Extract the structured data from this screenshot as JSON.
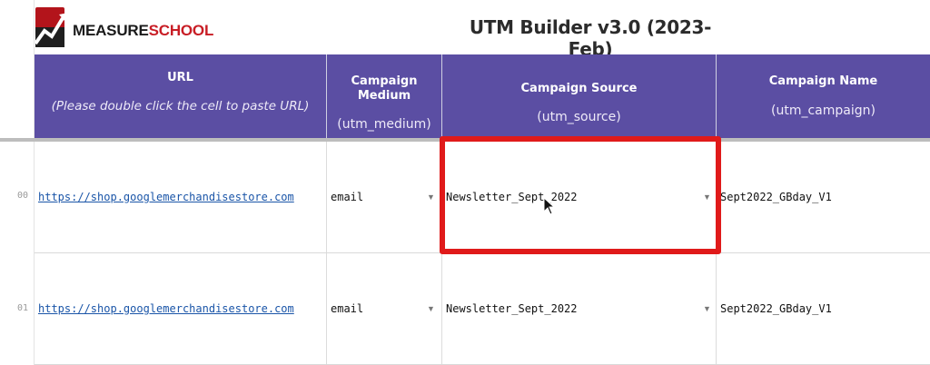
{
  "brand": {
    "logo_text_a": "MEASURE",
    "logo_text_b": "SCHOOL"
  },
  "title": "UTM Builder v3.0 (2023-Feb)",
  "columns": [
    {
      "label": "URL",
      "sub": "(Please double click the cell to paste URL)"
    },
    {
      "label": "Campaign Medium",
      "sub": "(utm_medium)"
    },
    {
      "label": "Campaign Source",
      "sub": "(utm_source)"
    },
    {
      "label": "Campaign Name",
      "sub": "(utm_campaign)"
    }
  ],
  "rows": [
    {
      "num": "00",
      "url": "https://shop.googlemerchandisestore.com",
      "medium": "email",
      "source": "Newsletter_Sept_2022",
      "name": "Sept2022_GBday_V1"
    },
    {
      "num": "01",
      "url": "https://shop.googlemerchandisestore.com",
      "medium": "email",
      "source": "Newsletter_Sept_2022",
      "name": "Sept2022_GBday_V1"
    }
  ],
  "colors": {
    "header_bg": "#5b4ea3",
    "highlight": "#e01a1a",
    "link": "#1a55a8"
  },
  "icons": {
    "dropdown": "caret-down-icon",
    "cursor": "mouse-pointer-icon",
    "logo": "chart-logo-icon"
  }
}
